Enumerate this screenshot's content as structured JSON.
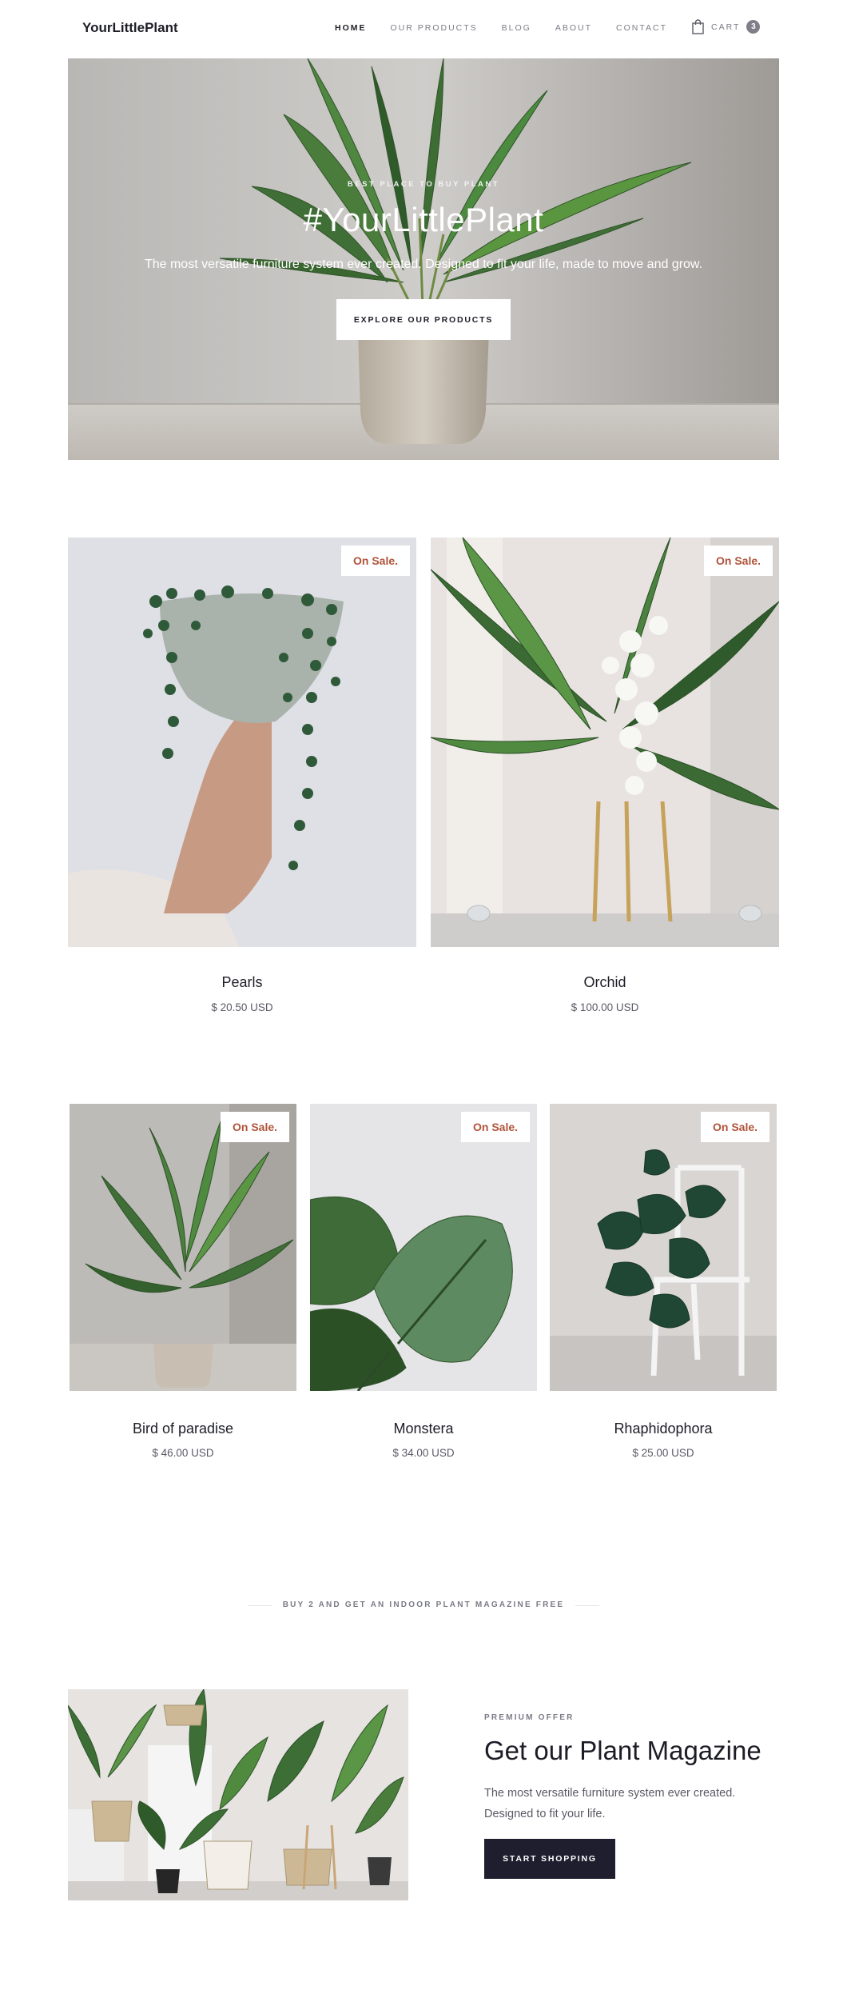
{
  "header": {
    "logo": "YourLittlePlant",
    "nav": [
      {
        "label": "HOME",
        "active": true
      },
      {
        "label": "OUR PRODUCTS",
        "active": false
      },
      {
        "label": "BLOG",
        "active": false
      },
      {
        "label": "ABOUT",
        "active": false
      },
      {
        "label": "CONTACT",
        "active": false
      }
    ],
    "cart": {
      "label": "CART",
      "count": "3",
      "icon": "shopping-bag-icon"
    }
  },
  "hero": {
    "eyebrow": "BEST PLACE TO BUY PLANT",
    "title": "#YourLittlePlant",
    "subtitle": "The most versatile furniture system ever created. Designed to fit your life, made to move and grow.",
    "button": "EXPLORE OUR PRODUCTS"
  },
  "products_row1": [
    {
      "name": "Pearls",
      "price": "$ 20.50 USD",
      "badge": "On Sale."
    },
    {
      "name": "Orchid",
      "price": "$ 100.00 USD",
      "badge": "On Sale."
    }
  ],
  "products_row2": [
    {
      "name": "Bird of paradise",
      "price": "$ 46.00 USD",
      "badge": "On Sale."
    },
    {
      "name": "Monstera",
      "price": "$ 34.00 USD",
      "badge": "On Sale."
    },
    {
      "name": "Rhaphidophora",
      "price": "$ 25.00 USD",
      "badge": "On Sale."
    }
  ],
  "promo": {
    "text": "BUY 2 AND GET AN INDOOR PLANT MAGAZINE FREE"
  },
  "magazine": {
    "eyebrow": "PREMIUM OFFER",
    "title": "Get our Plant Magazine",
    "description": "The most versatile furniture system ever created. Designed to fit your life.",
    "button": "START SHOPPING"
  },
  "colors": {
    "accent": "#b0533a",
    "dark": "#1e1e2e",
    "muted": "#7b7b86"
  }
}
